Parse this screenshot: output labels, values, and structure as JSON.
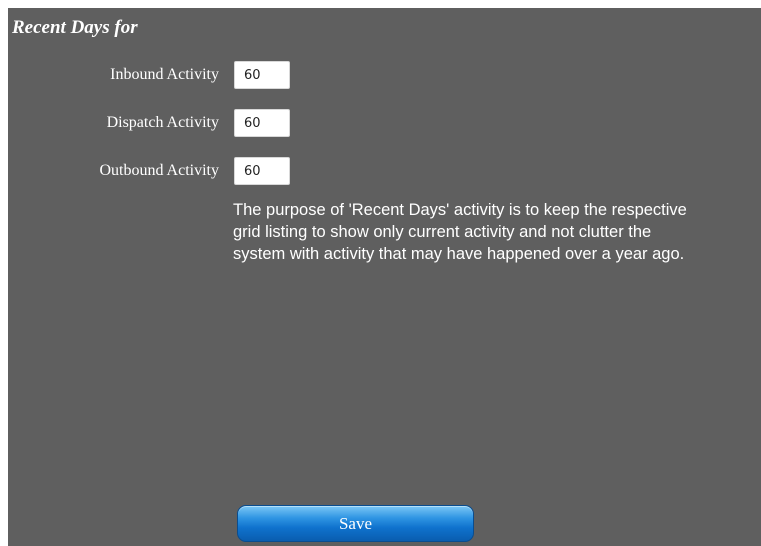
{
  "section": {
    "title": "Recent Days for"
  },
  "fields": {
    "inbound": {
      "label": "Inbound Activity",
      "value": "60"
    },
    "dispatch": {
      "label": "Dispatch Activity",
      "value": "60"
    },
    "outbound": {
      "label": "Outbound Activity",
      "value": "60"
    }
  },
  "description": {
    "line1": "The purpose of 'Recent Days' activity is to keep the respective",
    "line2": "grid listing to show only current activity and not clutter the",
    "line3": "system with activity that may have happened over a year ago."
  },
  "actions": {
    "save_label": "Save"
  },
  "colors": {
    "panel_background": "#5f5f5f",
    "text": "#ffffff",
    "save_button": "#1a7fd8"
  }
}
